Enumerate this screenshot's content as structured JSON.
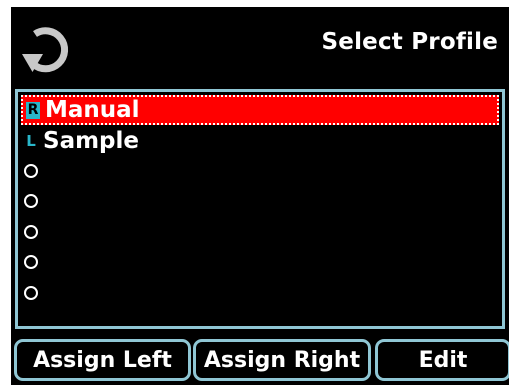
{
  "header": {
    "back_icon": "refresh-back-arrow-icon",
    "title": "Select Profile"
  },
  "profiles": [
    {
      "badge": "R",
      "label": "Manual",
      "selected": true
    },
    {
      "badge": "L",
      "label": "Sample",
      "selected": false
    },
    {
      "badge": "",
      "label": "",
      "selected": false
    },
    {
      "badge": "",
      "label": "",
      "selected": false
    },
    {
      "badge": "",
      "label": "",
      "selected": false
    },
    {
      "badge": "",
      "label": "",
      "selected": false
    },
    {
      "badge": "",
      "label": "",
      "selected": false
    }
  ],
  "buttons": {
    "assign_left": "Assign Left",
    "assign_right": "Assign Right",
    "edit": "Edit"
  },
  "colors": {
    "screen_bg": "#000000",
    "accent_border": "#8fc6d4",
    "selection": "#ff0000",
    "badge": "#29b6c9",
    "text": "#ffffff"
  }
}
